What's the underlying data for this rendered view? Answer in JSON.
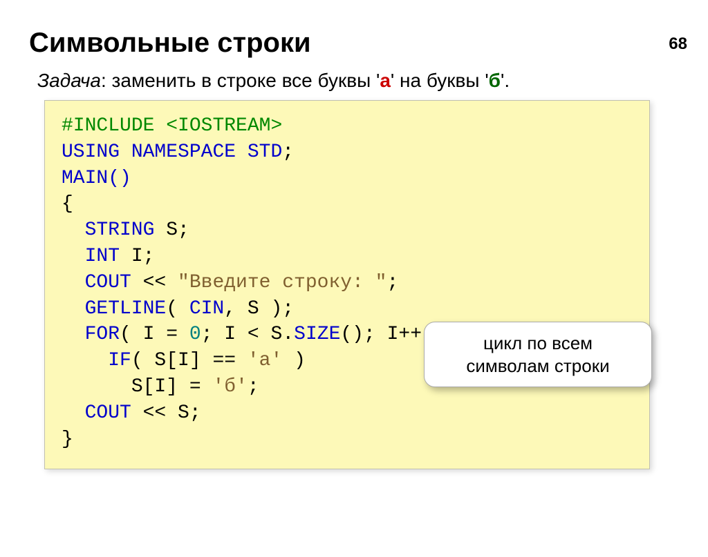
{
  "pageNumber": "68",
  "heading": "Символьные строки",
  "task": {
    "label": "Задача",
    "textBefore": ": заменить в строке все буквы '",
    "letterA": "а",
    "textMiddle": "' на буквы '",
    "letterB": "б",
    "textAfter": "'."
  },
  "code": {
    "include": {
      "directive": "#INCLUDE ",
      "header": "<IOSTREAM>"
    },
    "using": {
      "kw1": "USING ",
      "kw2": "NAMESPACE ",
      "kw3": "STD",
      "semi": ";"
    },
    "main": "MAIN()",
    "braceOpen": "{",
    "stringDecl": {
      "type": "STRING ",
      "var": "S;"
    },
    "intDecl": {
      "type": "INT ",
      "var": "I;"
    },
    "coutPrompt": {
      "kw": "COUT ",
      "op": "<< ",
      "str": "\"Введите строку: \"",
      "semi": ";"
    },
    "getline": {
      "fn": "GETLINE",
      "paren1": "( ",
      "arg1": "CIN",
      "comma": ", S )",
      "semi": ";"
    },
    "forLoop": {
      "kw": "FOR",
      "p1": "( I",
      "op1": "=",
      "zero": "0",
      "p2": "; I",
      "op2": "<",
      "p3": "S.",
      "size": "SIZE",
      "p4": "(); I",
      "inc": "++",
      "p5": " )"
    },
    "ifStmt": {
      "kw": "IF",
      "p1": "( S[I]",
      "op": "==",
      "ch": "'а'",
      "p2": " )"
    },
    "assign": {
      "lhs": "S[I]",
      "op": "=",
      "ch": "'б'",
      "semi": ";"
    },
    "coutS": {
      "kw": "COUT ",
      "op": "<< ",
      "var": "S;"
    },
    "braceClose": "}"
  },
  "callout": {
    "line1": "цикл по всем",
    "line2": "символам строки"
  }
}
